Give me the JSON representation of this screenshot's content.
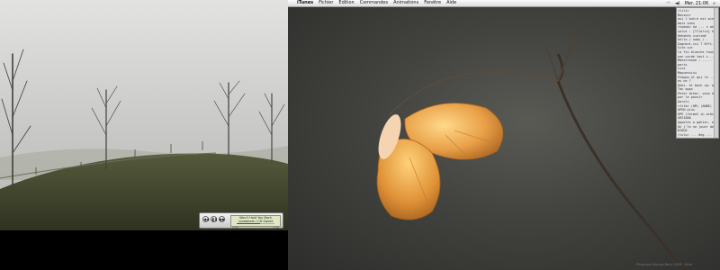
{
  "menubar": {
    "apple": "",
    "app": "iTunes",
    "menus": [
      "Fichier",
      "Edition",
      "Commandes",
      "Animations",
      "Fenêtre",
      "Aide"
    ],
    "clock": "Mer. 21:06"
  },
  "mini_player": {
    "track_title": "Won't Hold You Back",
    "track_album": "Lovebeats / CD Sweet",
    "elapsed": "2:53",
    "remaining": "-1:40",
    "progress": 0.63,
    "btn_prev": "◀◀",
    "btn_play": "❚❚",
    "btn_next": "▶▶"
  },
  "chat_lines": [
    "<lili>",
    "Bonsoir",
    "oui l'autre est mieux avec",
    "mais sans",
    "<tweak> ha ... c ah_o",
    "salut   : [Yllelin] haha euh",
    "Heheheh vintimé",
    "hello / nobu / -",
    "Gagnent.ini ? 0ffi.0d1",
    "Site sur",
    "la fin blanche tous tout en",
    "non corde tout i... ",
    "",
    "Maestronne : ..... T ou",
    "paris",
    "Luis",
    "Mapuessiui",
    "Steppe.nl qui le ... ",
    "",
    "eu ne ?",
    "Ahbi. hi back up: que",
    "Tau apps",
    "Peter dihor, vous dixit",
    "par le pouvir",
    "Aaroli",
    "<fifa> (OM) (ANNE)",
    "",
    "OPEN plus",
    "OPE (format in arbit)",
    "ARSIANA",
    "Appelez a gahier, en ...",
    "",
    "Ok j'le ne jouer de tout",
    "NIQUA",
    "<lulu> ... 0eg ... 1",
    "A oui",
    "Ouai",
    "Sirfinie",
    "L'exclu recluse, oke",
    "Moiz'Pris Ton le Kasing",
    "Ok, bien fin la coupe",
    "Noura 1.5 if 1 a le s"
  ],
  "watermark": "Photo par Nicolas Bony 2006 · flickr",
  "colors": {
    "menubar": "#e8e8e8",
    "lcd": "#dfe8c5",
    "leaf": "#e9a048",
    "fog_sky": "#d4d5d4",
    "grass": "#3e4228"
  },
  "icons": [
    "apple-logo-icon",
    "wifi-icon",
    "volume-icon",
    "spotlight-icon",
    "prev-icon",
    "pause-icon",
    "next-icon"
  ]
}
